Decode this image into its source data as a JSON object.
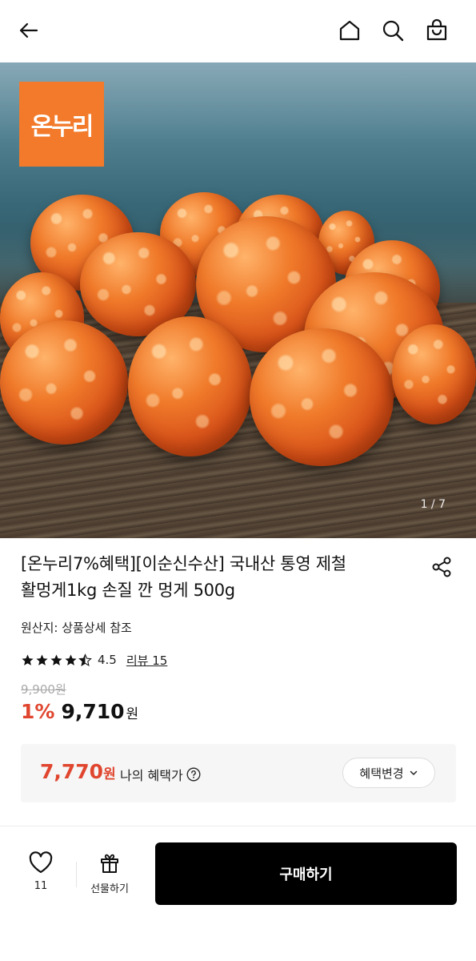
{
  "product": {
    "title_line1": "[온누리7%혜택][이순신수산] 국내산 통영 제철",
    "title_line2": "활멍게1kg 손질 깐 멍게 500g",
    "origin": "원산지: 상품상세 참조",
    "rating": "4.5",
    "review_link": "리뷰 15",
    "stars_value": 4.5,
    "original_price": "9,900원",
    "discount_percent": "1%",
    "sale_price": "9,710",
    "sale_price_unit": "원",
    "image_badge": "온누리",
    "image_page_indicator": "1 / 7"
  },
  "benefit": {
    "price": "7,770",
    "unit": "원",
    "label": "나의 혜택가",
    "change_button": "혜택변경"
  },
  "bottom_bar": {
    "like_count": "11",
    "gift_label": "선물하기",
    "buy_label": "구매하기"
  },
  "icons": {
    "back": "back-arrow-icon",
    "home": "home-icon",
    "search": "search-icon",
    "cart": "shopping-bag-icon",
    "share": "share-icon",
    "like": "heart-icon",
    "gift": "gift-icon",
    "help": "help-circle-icon",
    "dropdown": "chevron-down-icon"
  },
  "colors": {
    "accent_red": "#e0462f",
    "badge_orange": "#f27a2a",
    "buy_button": "#000000"
  }
}
